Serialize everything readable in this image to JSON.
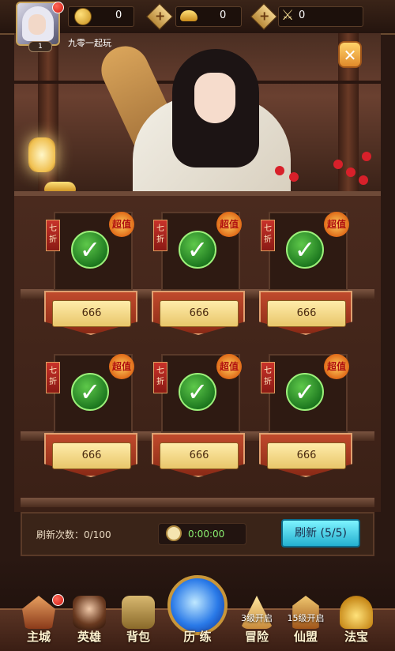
{
  "header": {
    "player": {
      "level": "1",
      "name": "九零一起玩"
    },
    "resources": [
      {
        "icon": "copper-coin-icon",
        "value": "0"
      },
      {
        "icon": "gold-ingot-icon",
        "value": "0"
      },
      {
        "icon": "crossed-swords-icon",
        "value": "0"
      }
    ]
  },
  "shop": {
    "items": [
      {
        "discount": "七折",
        "badge": "超值",
        "price": "666",
        "purchased": true
      },
      {
        "discount": "七折",
        "badge": "超值",
        "price": "666",
        "purchased": true
      },
      {
        "discount": "七折",
        "badge": "超值",
        "price": "666",
        "purchased": true
      },
      {
        "discount": "七折",
        "badge": "超值",
        "price": "666",
        "purchased": true
      },
      {
        "discount": "七折",
        "badge": "超值",
        "price": "666",
        "purchased": true
      },
      {
        "discount": "七折",
        "badge": "超值",
        "price": "666",
        "purchased": true
      }
    ],
    "refresh_count_label": "刷新次数：0/100",
    "timer": "0:00:00",
    "refresh_button": "刷新 (5/5)"
  },
  "nav": [
    {
      "label": "主城",
      "icon": "city-icon",
      "lock": ""
    },
    {
      "label": "英雄",
      "icon": "hero-icon",
      "lock": ""
    },
    {
      "label": "背包",
      "icon": "bag-icon",
      "lock": ""
    },
    {
      "label": "历 练",
      "icon": "portal-orb-icon",
      "lock": ""
    },
    {
      "label": "冒险",
      "icon": "adventure-icon",
      "lock": "3级开启"
    },
    {
      "label": "仙盟",
      "icon": "alliance-icon",
      "lock": "15级开启"
    },
    {
      "label": "法宝",
      "icon": "treasure-icon",
      "lock": ""
    }
  ],
  "colors": {
    "accent_gold": "#e8c66a",
    "refresh_cyan": "#24b0d0",
    "timer_green": "#8af070"
  }
}
